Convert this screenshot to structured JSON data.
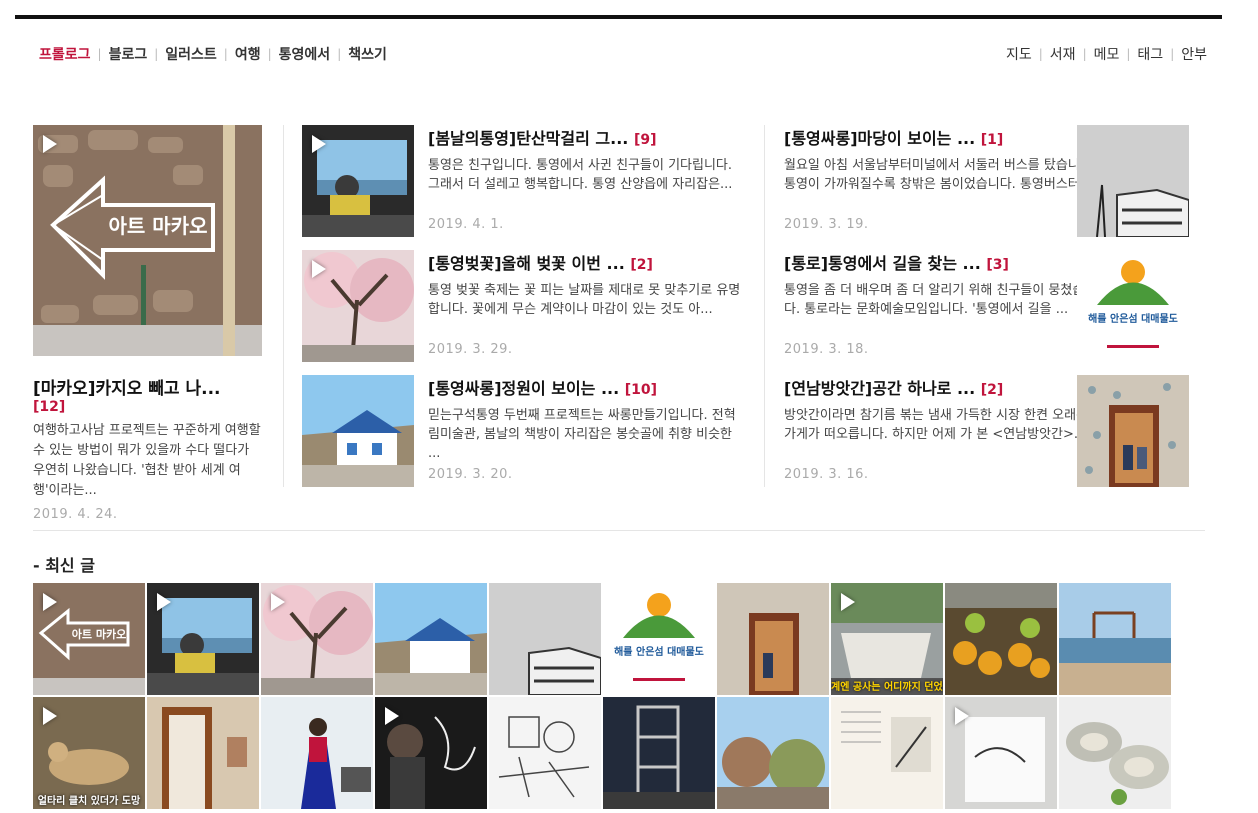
{
  "nav_left": [
    "프롤로그",
    "블로그",
    "일러스트",
    "여행",
    "통영에서",
    "책쓰기"
  ],
  "nav_right": [
    "지도",
    "서재",
    "메모",
    "태그",
    "안부"
  ],
  "featured": {
    "title": "[마카오]카지오 빼고 나...",
    "count": "[12]",
    "excerpt": "여행하고사남 프로젝트는 꾸준하게 여행할 수 있는 방법이 뭐가 있을까 수다 떨다가 우연히 나왔습니다. '협찬 받아 세계 여행'이라는...",
    "date": "2019. 4. 24.",
    "image_text": "아트 마카오"
  },
  "posts": [
    {
      "title": "[봄날의통영]탄산막걸리 그...",
      "count": "[9]",
      "excerpt": "통영은 친구입니다. 통영에서 사귄 친구들이 기다립니다. 그래서 더 설레고 행복합니다. 통영 산양읍에 자리잡은...",
      "date": "2019. 4. 1."
    },
    {
      "title": "[통영벚꽃]올해 벚꽃 이번 ...",
      "count": "[2]",
      "excerpt": "통영 벚꽃 축제는 꽃 피는 날짜를 제대로 못 맞추기로 유명합니다. 꽃에게 무슨 계약이나 마감이 있는 것도 아...",
      "date": "2019. 3. 29."
    },
    {
      "title": "[통영싸롱]정원이 보이는 ...",
      "count": "[10]",
      "excerpt": "믿는구석통영 두번째 프로젝트는 싸롱만들기입니다. 전혁림미술관, 봄날의 책방이 자리잡은 봉숫골에 취향 비슷한 ...",
      "date": "2019. 3. 20."
    },
    {
      "title": "[통영싸롱]마당이 보이는 ...",
      "count": "[1]",
      "excerpt": "월요일 아침 서울남부터미널에서 서둘러 버스를 탔습니다. 통영이 가까워질수록 창밖은 봄이었습니다. 통영버스터...",
      "date": "2019. 3. 19."
    },
    {
      "title": "[통로]통영에서 길을 찾는 ...",
      "count": "[3]",
      "excerpt": "통영을 좀 더 배우며 좀 더 알리기 위해 친구들이 뭉쳤습니다. 통로라는 문화예술모임입니다. '통영에서 길을 ...",
      "date": "2019. 3. 18.",
      "image_text": "해를 안은섬 대매물도"
    },
    {
      "title": "[연남방앗간]공간 하나로 ...",
      "count": "[2]",
      "excerpt": "방앗간이라면 참기름 볶는 냄새 가득한 시장 한켠 오래된 가게가 떠오릅니다. 하지만 어제 가 본 <연남방앗간>...",
      "date": "2019. 3. 16."
    }
  ],
  "recent": {
    "heading": "- 최신 글",
    "tile_texts": {
      "macao": "아트 마카오",
      "island": "해를 안은섬 대매물도",
      "caption8": "계엔 공사는 어디까지 던었을까요?",
      "caption11": "얼타리 클치 있더가 도망"
    }
  }
}
